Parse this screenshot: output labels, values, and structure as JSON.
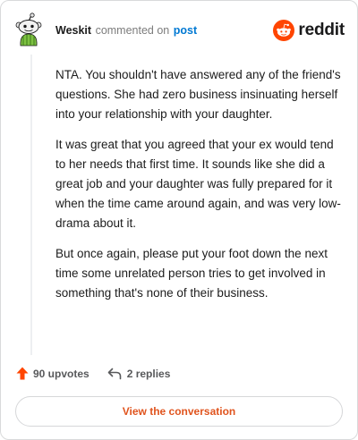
{
  "header": {
    "username": "Weskit",
    "commented_text": "commented on",
    "post_link": "post",
    "brand": "reddit"
  },
  "comment": {
    "paragraphs": [
      "NTA. You shouldn't have answered any of the friend's questions. She had zero business insinuating herself into your relationship with your daughter.",
      "It was great that you agreed that your ex would tend to her needs that first time. It sounds like she did a great job and your daughter was fully prepared for it when the time came around again, and was very low-drama about it.",
      "But once again, please put your foot down the next time some unrelated person tries to get involved in something that's none of their business."
    ]
  },
  "actions": {
    "upvotes": "90 upvotes",
    "replies": "2 replies"
  },
  "cta": {
    "label": "View the conversation"
  },
  "colors": {
    "accent": "#ff4500",
    "link": "#0079d3",
    "cta_text": "#e0541e"
  },
  "icons": [
    "snoo-avatar-icon",
    "reddit-logo-icon",
    "upvote-arrow-icon",
    "reply-arrow-icon"
  ]
}
